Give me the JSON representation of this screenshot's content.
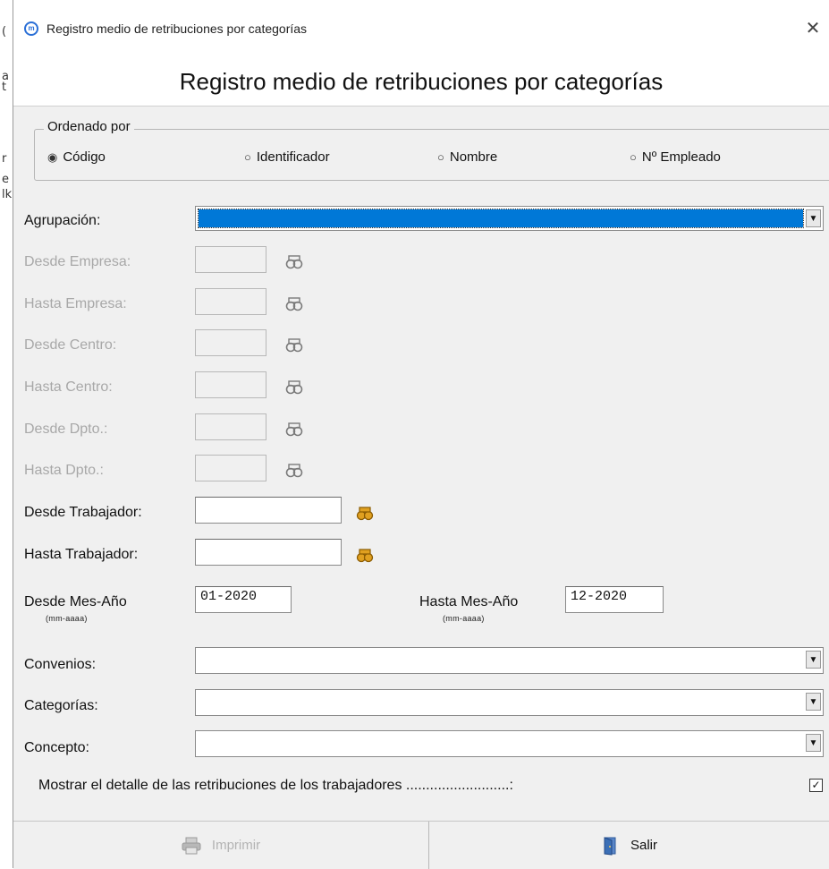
{
  "window": {
    "title": "Registro medio de retribuciones por categorías",
    "close_glyph": "✕",
    "app_icon_letter": "m"
  },
  "edge_glyphs": [
    "(",
    "a",
    "t",
    "r",
    "e",
    "lk"
  ],
  "header": {
    "title": "Registro medio de retribuciones por categorías"
  },
  "sort": {
    "legend": "Ordenado por",
    "options": [
      {
        "label": "Código",
        "selected": true
      },
      {
        "label": "Identificador",
        "selected": false
      },
      {
        "label": "Nombre",
        "selected": false
      },
      {
        "label": "Nº Empleado",
        "selected": false
      }
    ]
  },
  "fields": {
    "agrupacion": {
      "label": "Agrupación:",
      "value": ""
    },
    "desde_empresa": {
      "label": "Desde Empresa:",
      "value": "",
      "enabled": false
    },
    "hasta_empresa": {
      "label": "Hasta Empresa:",
      "value": "",
      "enabled": false
    },
    "desde_centro": {
      "label": "Desde Centro:",
      "value": "",
      "enabled": false
    },
    "hasta_centro": {
      "label": "Hasta Centro:",
      "value": "",
      "enabled": false
    },
    "desde_dpto": {
      "label": "Desde Dpto.:",
      "value": "",
      "enabled": false
    },
    "hasta_dpto": {
      "label": "Hasta Dpto.:",
      "value": "",
      "enabled": false
    },
    "desde_trabajador": {
      "label": "Desde Trabajador:",
      "value": "",
      "enabled": true
    },
    "hasta_trabajador": {
      "label": "Hasta Trabajador:",
      "value": "",
      "enabled": true
    },
    "desde_mes": {
      "label": "Desde Mes-Año",
      "hint": "(mm-aaaa)",
      "value": "01-2020"
    },
    "hasta_mes": {
      "label": "Hasta Mes-Año",
      "hint": "(mm-aaaa)",
      "value": "12-2020"
    },
    "convenios": {
      "label": "Convenios:",
      "value": ""
    },
    "categorias": {
      "label": "Categorías:",
      "value": ""
    },
    "concepto": {
      "label": "Concepto:",
      "value": ""
    }
  },
  "detail": {
    "label": "Mostrar el detalle de las retribuciones de los trabajadores ..........................:",
    "checked": true,
    "check_glyph": "✓"
  },
  "buttons": {
    "print": {
      "label": "Imprimir",
      "enabled": false
    },
    "exit": {
      "label": "Salir",
      "enabled": true
    }
  },
  "colors": {
    "selection": "#0078d7",
    "lookup_enabled": "#e0a020",
    "lookup_disabled": "#7a7a7a",
    "exit_icon": "#3b6fb6",
    "print_icon": "#9a9a9a"
  },
  "icons": {
    "lookup": "binoculars-icon",
    "print": "printer-icon",
    "exit": "door-exit-icon",
    "dropdown": "chevron-down-icon",
    "radio": "radio-icon"
  },
  "glyphs": {
    "radio_on": "◉",
    "radio_off": "○",
    "dropdown": "▼"
  }
}
